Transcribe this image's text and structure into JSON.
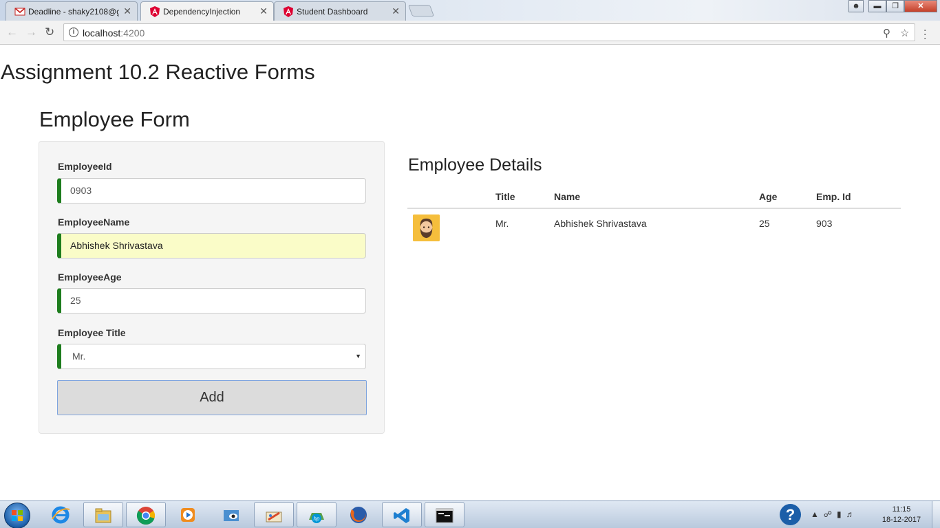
{
  "browser": {
    "tabs": [
      {
        "label": "Deadline - shaky2108@g",
        "icon": "gmail-icon"
      },
      {
        "label": "DependencyInjection",
        "icon": "angular-icon",
        "active": true
      },
      {
        "label": "Student Dashboard",
        "icon": "angular-icon"
      }
    ],
    "close_glyph": "✕",
    "url_host": "localhost",
    "url_port": ":4200"
  },
  "page": {
    "title": "Assignment 10.2 Reactive Forms",
    "form": {
      "title": "Employee Form",
      "fields": {
        "id": {
          "label": "EmployeeId",
          "value": "0903"
        },
        "name": {
          "label": "EmployeeName",
          "value": "Abhishek Shrivastava"
        },
        "age": {
          "label": "EmployeeAge",
          "value": "25"
        },
        "title": {
          "label": "Employee Title",
          "value": "Mr."
        }
      },
      "add_label": "Add"
    },
    "details": {
      "title": "Employee Details",
      "columns": [
        "Title",
        "Name",
        "Age",
        "Emp. Id"
      ],
      "rows": [
        {
          "avatar": "avatar-icon",
          "title": "Mr.",
          "name": "Abhishek Shrivastava",
          "age": "25",
          "emp_id": "903"
        }
      ]
    }
  },
  "taskbar": {
    "items": [
      "internet-explorer-icon",
      "file-explorer-icon",
      "chrome-icon",
      "media-player-icon",
      "snipping-tool-icon",
      "paint-icon",
      "hp-icon",
      "firefox-icon",
      "visual-studio-code-icon",
      "command-prompt-icon"
    ],
    "clock_time": "11:15",
    "clock_date": "18-12-2017"
  },
  "colors": {
    "valid_border": "#1e7d1e",
    "autofill_bg": "#fafcc8",
    "avatar_bg": "#f5be3c"
  }
}
